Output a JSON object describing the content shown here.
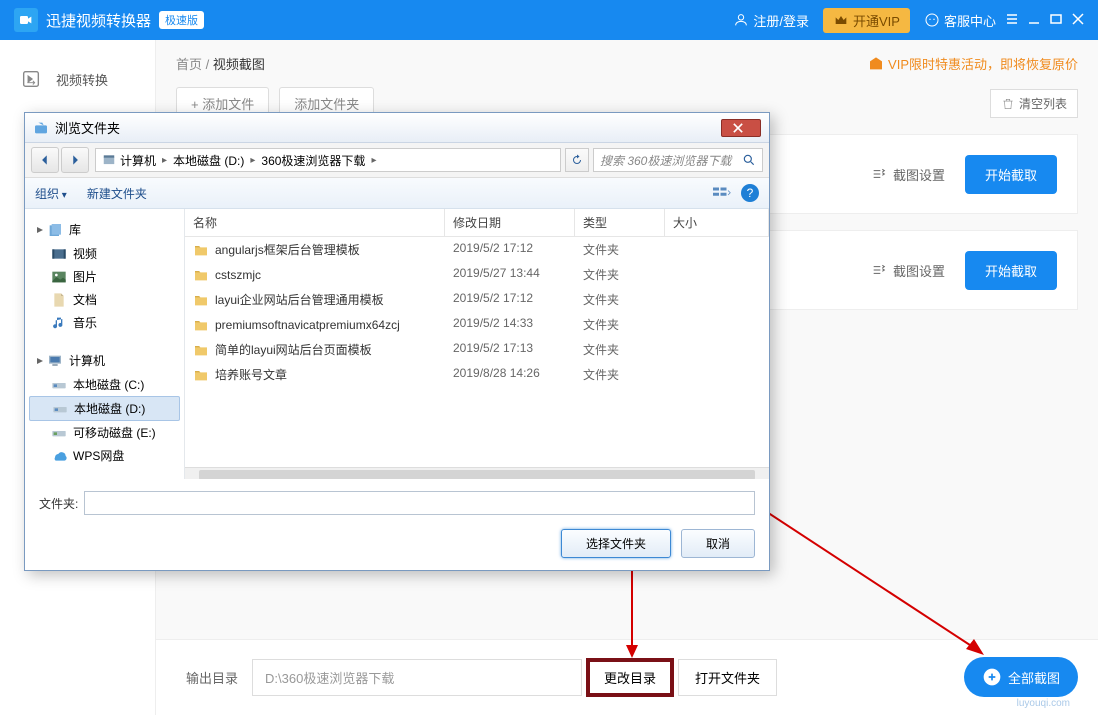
{
  "app": {
    "title": "迅捷视频转换器",
    "edition": "极速版"
  },
  "header": {
    "register": "注册/登录",
    "vip": "开通VIP",
    "help": "客服中心"
  },
  "sidebar": {
    "convert": "视频转换"
  },
  "breadcrumb": {
    "home": "首页",
    "current": "视频截图"
  },
  "vipPromo": "VIP限时特惠活动，即将恢复原价",
  "toolbar": {
    "addFile": "+ 添加文件",
    "addFolder": "添加文件夹",
    "clear": "清空列表"
  },
  "task": {
    "settings": "截图设置",
    "start": "开始截取"
  },
  "bottom": {
    "label": "输出目录",
    "path": "D:\\360极速浏览器下载",
    "change": "更改目录",
    "open": "打开文件夹"
  },
  "floatBadge": {
    "text": "全部截图",
    "sub": "luyouqi.com"
  },
  "dialog": {
    "title": "浏览文件夹",
    "path": {
      "seg1": "计算机",
      "seg2": "本地磁盘 (D:)",
      "seg3": "360极速浏览器下载"
    },
    "searchPlaceholder": "搜索 360极速浏览器下载",
    "tb": {
      "org": "组织",
      "newFolder": "新建文件夹"
    },
    "tree": {
      "lib": "库",
      "video": "视频",
      "image": "图片",
      "doc": "文档",
      "music": "音乐",
      "computer": "计算机",
      "c": "本地磁盘 (C:)",
      "d": "本地磁盘 (D:)",
      "e": "可移动磁盘 (E:)",
      "wps": "WPS网盘"
    },
    "headers": {
      "name": "名称",
      "date": "修改日期",
      "type": "类型",
      "size": "大小"
    },
    "typeFolder": "文件夹",
    "rows": [
      {
        "name": "angularjs框架后台管理模板",
        "date": "2019/5/2 17:12"
      },
      {
        "name": "cstszmjc",
        "date": "2019/5/27 13:44"
      },
      {
        "name": "layui企业网站后台管理通用模板",
        "date": "2019/5/2 17:12"
      },
      {
        "name": "premiumsoftnavicatpremiumx64zcj",
        "date": "2019/5/2 14:33"
      },
      {
        "name": "简单的layui网站后台页面模板",
        "date": "2019/5/2 17:13"
      },
      {
        "name": "培养账号文章",
        "date": "2019/8/28 14:26"
      }
    ],
    "folderLabel": "文件夹:",
    "ok": "选择文件夹",
    "cancel": "取消"
  }
}
